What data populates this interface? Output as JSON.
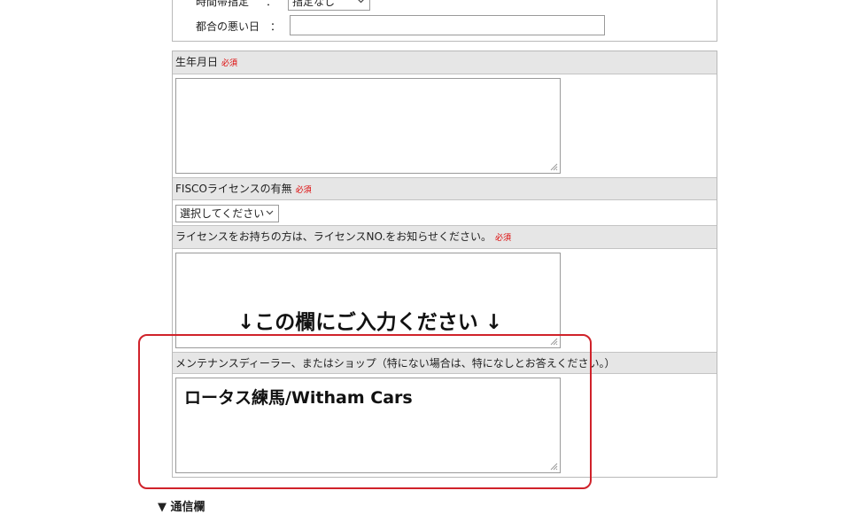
{
  "delivery": {
    "time_label": "時間帯指定",
    "colon": "：",
    "time_value": "指定なし",
    "bad_day_label": "都合の悪い日",
    "bad_day_value": ""
  },
  "birthday": {
    "label": "生年月日",
    "required": "必須",
    "value": ""
  },
  "fisco": {
    "label": "FISCOライセンスの有無",
    "required": "必須",
    "select_value": "選択してください"
  },
  "license_no": {
    "label": "ライセンスをお持ちの方は、ライセンスNO.をお知らせください。",
    "required": "必須",
    "value": ""
  },
  "instruction_overlay": "↓この欄にご入力ください ↓",
  "maintenance": {
    "label": "メンテナンスディーラー、またはショップ（特にない場合は、特になしとお答えください。）",
    "value": "ロータス練馬/Witham Cars"
  },
  "section_next": {
    "marker": "▼",
    "title": "通信欄"
  }
}
